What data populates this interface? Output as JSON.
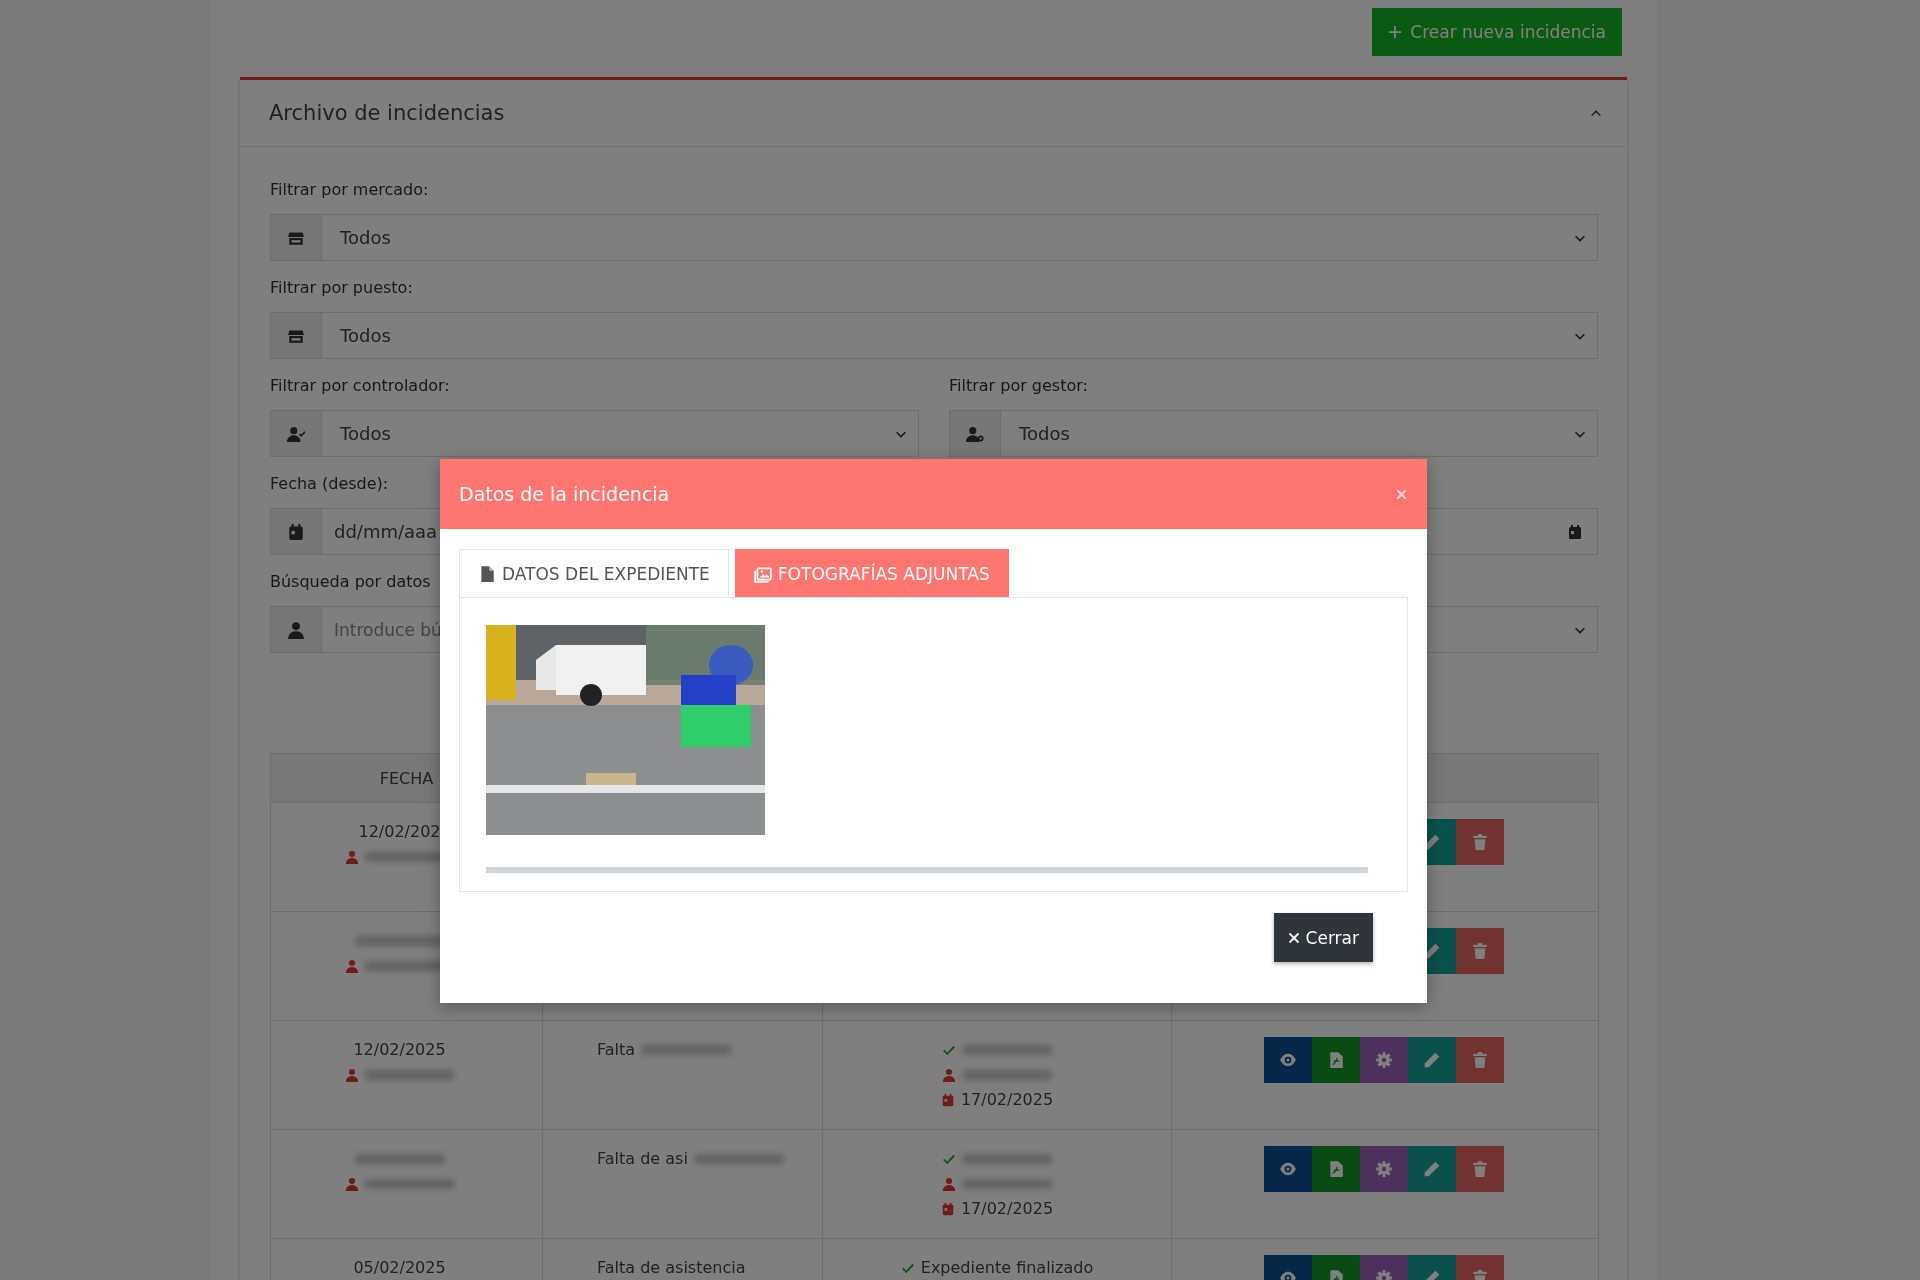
{
  "create_button": {
    "label": "Crear nueva incidencia"
  },
  "card": {
    "title": "Archivo de incidencias",
    "expanded": true
  },
  "filters": [
    {
      "kind": "select",
      "label": "Filtrar por mercado:",
      "value": "Todos"
    },
    {
      "kind": "select",
      "label": "Filtrar por puesto:",
      "value": "Todos"
    }
  ],
  "filter_pair": [
    {
      "label": "Filtrar por controlador:",
      "value": "Todos"
    },
    {
      "label": "Filtrar por gestor:",
      "value": "Todos"
    }
  ],
  "date_filter": {
    "label": "Fecha (desde):",
    "value": "dd/mm/aaa"
  },
  "search_filter": {
    "label": "Búsqueda por datos",
    "placeholder": "Introduce bú"
  },
  "table": {
    "columns": [
      "FECHA"
    ],
    "rows": [
      {
        "cells": [
          [
            {
              "kind": "plain",
              "text": "12/02/202",
              "redacted": false
            },
            {
              "kind": "person",
              "redacted": true
            }
          ],
          [],
          []
        ],
        "actions": [
          {
            "kind": "edit"
          },
          {
            "kind": "delete"
          }
        ]
      },
      {
        "cells": [
          [
            {
              "kind": "plain",
              "redacted": true
            },
            {
              "kind": "person",
              "redacted": true
            }
          ],
          [],
          []
        ],
        "actions": [
          {
            "kind": "edit"
          },
          {
            "kind": "delete"
          }
        ]
      },
      {
        "cells": [
          [
            {
              "kind": "plain",
              "text": "12/02/2025",
              "redacted": false
            },
            {
              "kind": "person",
              "redacted": true
            }
          ],
          [
            {
              "kind": "plain",
              "text": "Falta",
              "redacted": true
            }
          ],
          [
            {
              "kind": "check",
              "redacted": true
            },
            {
              "kind": "person",
              "redacted": true
            },
            {
              "kind": "calendar",
              "text": "17/02/2025",
              "redacted": false
            }
          ]
        ],
        "actions": [
          {
            "kind": "view"
          },
          {
            "kind": "pdf"
          },
          {
            "kind": "settings"
          },
          {
            "kind": "edit"
          },
          {
            "kind": "delete"
          }
        ]
      },
      {
        "cells": [
          [
            {
              "kind": "plain",
              "redacted": true
            },
            {
              "kind": "person",
              "redacted": true
            }
          ],
          [
            {
              "kind": "plain",
              "text": "Falta de asi",
              "redacted": true
            }
          ],
          [
            {
              "kind": "check",
              "redacted": true
            },
            {
              "kind": "person",
              "redacted": true
            },
            {
              "kind": "calendar",
              "text": "17/02/2025",
              "redacted": false
            }
          ]
        ],
        "actions": [
          {
            "kind": "view"
          },
          {
            "kind": "pdf"
          },
          {
            "kind": "settings"
          },
          {
            "kind": "edit"
          },
          {
            "kind": "delete"
          }
        ]
      },
      {
        "cells": [
          [
            {
              "kind": "plain",
              "text": "05/02/2025",
              "redacted": false
            }
          ],
          [
            {
              "kind": "plain",
              "text": "Falta de asistencia",
              "redacted": false
            }
          ],
          [
            {
              "kind": "check",
              "text": "Expediente finalizado",
              "redacted": false
            }
          ]
        ],
        "actions": [
          {
            "kind": "view"
          },
          {
            "kind": "pdf"
          },
          {
            "kind": "settings"
          },
          {
            "kind": "edit"
          },
          {
            "kind": "delete"
          }
        ]
      }
    ]
  },
  "modal": {
    "title": "Datos de la incidencia",
    "tabs": [
      {
        "label": "DATOS DEL EXPEDIENTE",
        "selected": false
      },
      {
        "label": "FOTOGRAFÍAS ADJUNTAS",
        "selected": true
      }
    ],
    "close_button": {
      "label": "Cerrar"
    }
  }
}
